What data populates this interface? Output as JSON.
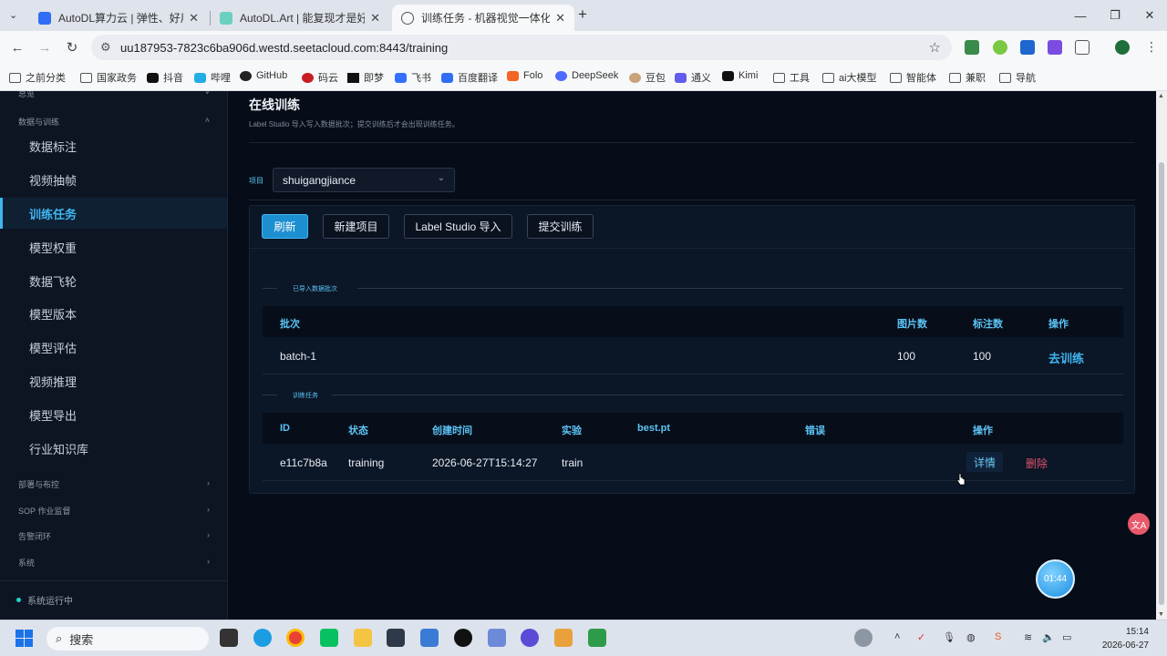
{
  "browser": {
    "tabs": [
      {
        "title": "AutoDL算力云 | 弹性、好用、省",
        "active": false
      },
      {
        "title": "AutoDL.Art | 能复现才是好算法",
        "active": false
      },
      {
        "title": "训练任务 - 机器视觉一体化服务",
        "active": true
      }
    ],
    "tab_close": "✕",
    "new_tab": "+",
    "url": "uu187953-7823c6ba906d.westd.seetacloud.com:8443/training",
    "bookmarks": [
      "之前分类",
      "国家政务",
      "抖音",
      "哔哩",
      "GitHub",
      "码云",
      "即梦",
      "飞书",
      "百度翻译",
      "Folo",
      "DeepSeek",
      "豆包",
      "通义",
      "Kimi",
      "工具",
      "ai大模型",
      "智能体",
      "兼职",
      "导航"
    ]
  },
  "sidebar": {
    "top_partial": "总览",
    "section_data": "数据与训练",
    "items": [
      {
        "label": "数据标注"
      },
      {
        "label": "视频抽帧"
      },
      {
        "label": "训练任务",
        "active": true
      },
      {
        "label": "模型权重"
      },
      {
        "label": "数据飞轮"
      },
      {
        "label": "模型版本"
      },
      {
        "label": "模型评估"
      },
      {
        "label": "视频推理"
      },
      {
        "label": "模型导出"
      },
      {
        "label": "行业知识库"
      }
    ],
    "sections": [
      "部署与布控",
      "SOP 作业监督",
      "告警闭环",
      "系统"
    ],
    "status": "系统运行中"
  },
  "main": {
    "title": "在线训练",
    "subtitle": "Label Studio 导入写入数据批次；提交训练后才会出现训练任务。",
    "project_label": "项目",
    "project_value": "shuigangjiance",
    "toolbar": {
      "refresh": "刷新",
      "new_project": "新建项目",
      "ls_import": "Label Studio 导入",
      "submit_train": "提交训练"
    },
    "batches_title": "已导入数据批次",
    "batches_headers": {
      "batch": "批次",
      "images": "图片数",
      "labels": "标注数",
      "action": "操作"
    },
    "batches": [
      {
        "batch": "batch-1",
        "images": "100",
        "labels": "100",
        "action": "去训练"
      }
    ],
    "jobs_title": "训练任务",
    "jobs_headers": {
      "id": "ID",
      "status": "状态",
      "created": "创建时间",
      "experiment": "实验",
      "best": "best.pt",
      "error": "错误",
      "action": "操作"
    },
    "jobs": [
      {
        "id": "e11c7b8a",
        "status": "training",
        "created": "2026-06-27T15:14:27",
        "experiment": "train",
        "best": "",
        "error": "",
        "detail": "详情",
        "delete": "删除"
      }
    ]
  },
  "widgets": {
    "timer": "01:44"
  },
  "taskbar": {
    "search": "搜索",
    "time": "15:14",
    "date": "2026-06-27"
  },
  "colors": {
    "accent": "#3fb6f2",
    "danger": "#e0526a",
    "app_bg": "#070d18"
  }
}
